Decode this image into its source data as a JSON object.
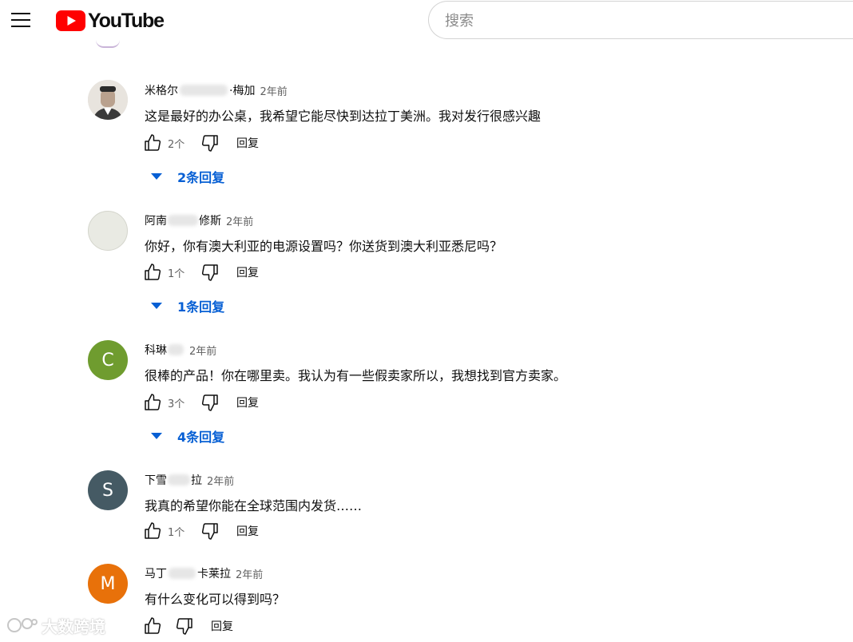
{
  "header": {
    "logo_text": "YouTube",
    "search_placeholder": "搜索"
  },
  "comments": [
    {
      "name_start": "米格尔",
      "name_end": "·梅加",
      "time": "2年前",
      "text": "这是最好的办公桌，我希望它能尽快到达拉丁美洲。我对发行很感兴趣",
      "likes": "2个",
      "reply_label": "回复",
      "replies_label": "2条回复",
      "avatar_type": "photo"
    },
    {
      "name_start": "阿南",
      "name_end": "修斯",
      "time": "2年前",
      "text": "你好，你有澳大利亚的电源设置吗？你送货到澳大利亚悉尼吗？",
      "likes": "1个",
      "reply_label": "回复",
      "replies_label": "1条回复",
      "avatar_type": "plain",
      "avatar_color": "#e9eae3"
    },
    {
      "name_start": "科琳",
      "name_end": "",
      "time": "2年前",
      "text": "很棒的产品！你在哪里卖。我认为有一些假卖家所以，我想找到官方卖家。",
      "likes": "3个",
      "reply_label": "回复",
      "replies_label": "4条回复",
      "avatar_letter": "C",
      "avatar_color": "#6f9c2f"
    },
    {
      "name_start": "下雪",
      "name_end": "拉",
      "time": "2年前",
      "text": "我真的希望你能在全球范围内发货……",
      "likes": "1个",
      "reply_label": "回复",
      "avatar_letter": "S",
      "avatar_color": "#455a64"
    },
    {
      "name_start": "马丁",
      "name_end": "卡莱拉",
      "time": "2年前",
      "text": "有什么变化可以得到吗？",
      "likes": "",
      "reply_label": "回复",
      "avatar_letter": "M",
      "avatar_color": "#e8710a"
    }
  ],
  "watermark": "大数跨境"
}
